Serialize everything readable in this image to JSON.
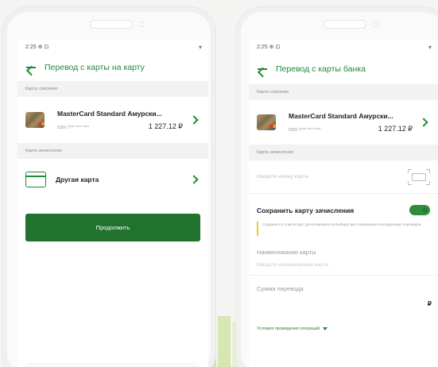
{
  "left": {
    "status_time": "2:25",
    "status_icons": "⊕ ⊡",
    "status_signal": "▾",
    "title": "Перевод с карты на карту",
    "debit_section": "Карта списания",
    "debit_card": {
      "name": "MasterCard Standard Амурски...",
      "number": "5356 77** **** ****",
      "amount": "1 227.12 ₽"
    },
    "credit_section": "Карта зачисления",
    "other_card_label": "Другая карта",
    "continue_label": "Продолжить"
  },
  "right": {
    "status_time": "2:25",
    "status_icons": "⊕ ⊡",
    "status_signal": "▾",
    "title": "Перевод с карты банка",
    "debit_section": "Карта списания",
    "debit_card": {
      "name": "MasterCard Standard Амурски...",
      "number": "5356 77** **** ****",
      "amount": "1 227.12 ₽"
    },
    "credit_section": "Карта зачисления",
    "card_number_placeholder": "Введите номер карты",
    "save_card_label": "Сохранить карту зачисления",
    "save_card_on": true,
    "save_card_hint": "Сохранить в список карт для возможности выбора при совершении последующих переводов",
    "card_name_label": "Наименование карты",
    "card_name_placeholder": "Введите наименование карты",
    "sum_label": "Сумма перевода",
    "currency": "₽",
    "conditions_label": "Условия проведения операций"
  },
  "colors": {
    "brand_green": "#1f8a37",
    "button_green": "#21722f",
    "accent_stripe": "#d7e6b3",
    "hint_bar": "#f2c83a"
  }
}
